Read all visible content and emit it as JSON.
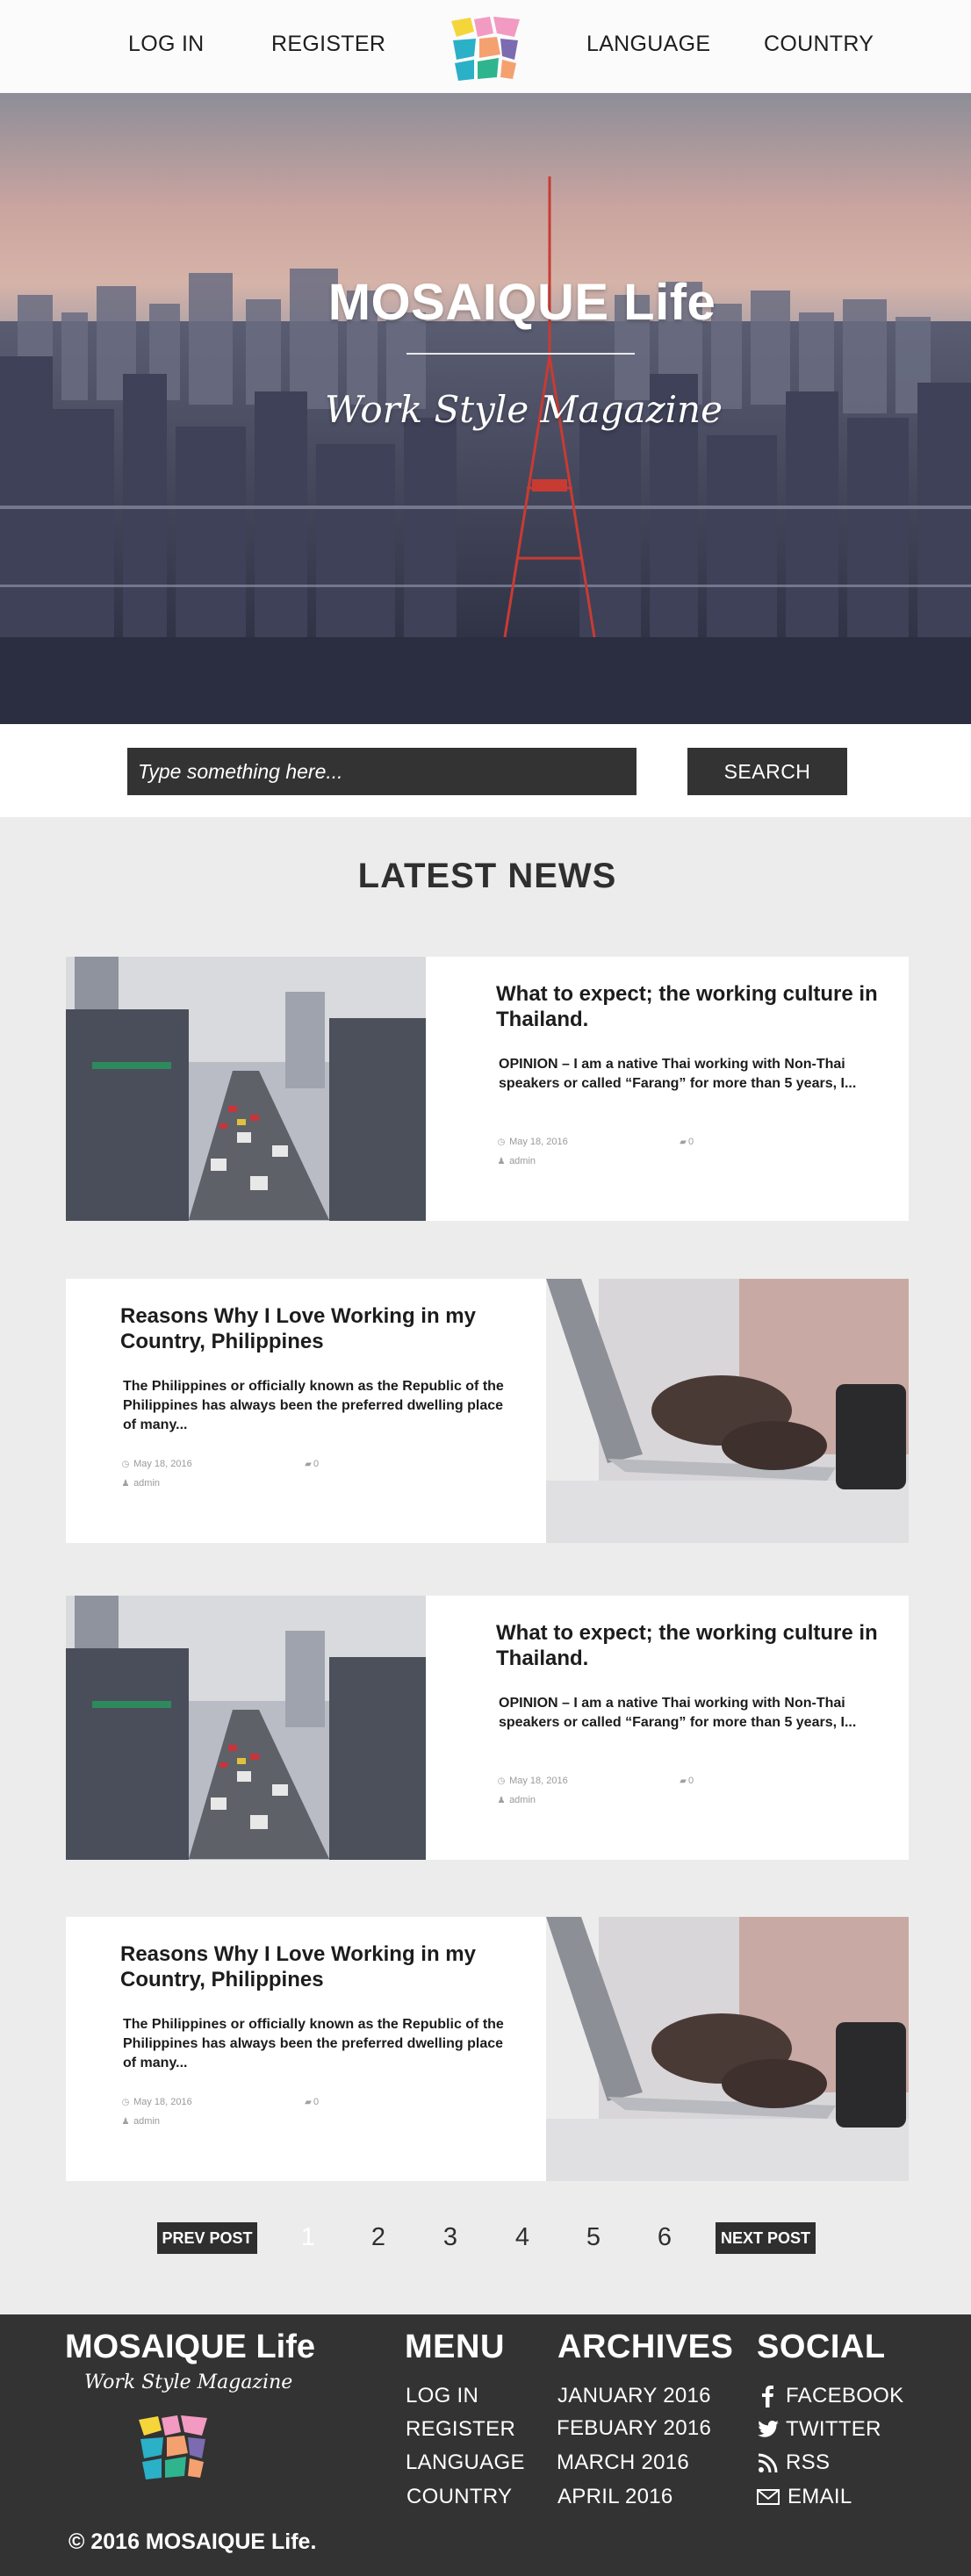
{
  "nav": {
    "login": "LOG IN",
    "register": "REGISTER",
    "language": "LANGUAGE",
    "country": "COUNTRY",
    "logo_icon": "mosaic-logo-icon"
  },
  "hero": {
    "title": "MOSAIQUE Life",
    "subtitle": "Work Style Magazine"
  },
  "search": {
    "placeholder": "Type something here...",
    "button": "SEARCH"
  },
  "news": {
    "heading": "LATEST NEWS",
    "posts": [
      {
        "title": "What to expect; the working culture in Thailand.",
        "excerpt": "OPINION – I am a native Thai working with Non-Thai speakers or called “Farang” for more than 5 years, I...",
        "date": "May 18, 2016",
        "comments": "0",
        "author": "admin",
        "image": "city-street-traffic-photo"
      },
      {
        "title": "Reasons Why I Love Working in my Country, Philippines",
        "excerpt": "The Philippines or officially known as the Republic of the Philippines has always been the preferred dwelling place of many...",
        "date": "May 18, 2016",
        "comments": "0",
        "author": "admin",
        "image": "hands-typing-laptop-photo"
      },
      {
        "title": "What to expect; the working culture in Thailand.",
        "excerpt": "OPINION – I am a native Thai working with Non-Thai speakers or called “Farang” for more than 5 years, I...",
        "date": "May 18, 2016",
        "comments": "0",
        "author": "admin",
        "image": "city-street-traffic-photo"
      },
      {
        "title": "Reasons Why I Love Working in my Country, Philippines",
        "excerpt": "The Philippines or officially known as the Republic of the Philippines has always been the preferred dwelling place of many...",
        "date": "May 18, 2016",
        "comments": "0",
        "author": "admin",
        "image": "hands-typing-laptop-photo"
      }
    ]
  },
  "pagination": {
    "prev": "PREV POST",
    "next": "NEXT POST",
    "pages": [
      "1",
      "2",
      "3",
      "4",
      "5",
      "6"
    ],
    "current": "1"
  },
  "footer": {
    "brand": "MOSAIQUE Life",
    "tagline": "Work Style Magazine",
    "copyright": "© 2016 MOSAIQUE Life.",
    "menu": {
      "heading": "MENU",
      "items": [
        "LOG IN",
        "REGISTER",
        "LANGUAGE",
        "COUNTRY"
      ]
    },
    "archives": {
      "heading": "ARCHIVES",
      "items": [
        "JANUARY 2016",
        "FEBUARY 2016",
        "MARCH 2016",
        "APRIL 2016"
      ]
    },
    "social": {
      "heading": "SOCIAL",
      "items": [
        {
          "label": "FACEBOOK",
          "icon": "facebook-icon"
        },
        {
          "label": "TWITTER",
          "icon": "twitter-icon"
        },
        {
          "label": "RSS",
          "icon": "rss-icon"
        },
        {
          "label": "EMAIL",
          "icon": "email-icon"
        }
      ]
    }
  },
  "colors": {
    "dark": "#333333",
    "page_bg": "#ececec",
    "card_bg": "#ffffff",
    "header_bg": "#fbfbfb"
  }
}
